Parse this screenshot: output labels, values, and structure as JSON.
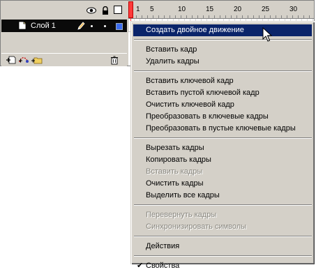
{
  "timeline": {
    "layer_name": "Слой 1",
    "ruler_ticks": [
      "1",
      "5",
      "10",
      "15",
      "20",
      "25",
      "30"
    ]
  },
  "menu": {
    "items": [
      {
        "label": "Создать двойное движение",
        "state": "highlighted"
      },
      {
        "separator": true
      },
      {
        "label": "Вставить кадр",
        "state": "enabled"
      },
      {
        "label": "Удалить кадры",
        "state": "enabled"
      },
      {
        "separator": true
      },
      {
        "label": "Вставить ключевой кадр",
        "state": "enabled"
      },
      {
        "label": "Вставить пустой ключевой кадр",
        "state": "enabled"
      },
      {
        "label": "Очистить ключевой кадр",
        "state": "enabled"
      },
      {
        "label": "Преобразовать в ключевые кадры",
        "state": "enabled"
      },
      {
        "label": "Преобразовать в пустые ключевые кадры",
        "state": "enabled"
      },
      {
        "separator": true
      },
      {
        "label": "Вырезать кадры",
        "state": "enabled"
      },
      {
        "label": "Копировать кадры",
        "state": "enabled"
      },
      {
        "label": "Вставить кадры",
        "state": "disabled"
      },
      {
        "label": "Очистить кадры",
        "state": "enabled"
      },
      {
        "label": "Выделить все кадры",
        "state": "enabled"
      },
      {
        "separator": true
      },
      {
        "label": "Перевернуть кадры",
        "state": "disabled"
      },
      {
        "label": "Синхронизировать символы",
        "state": "disabled"
      },
      {
        "separator": true
      },
      {
        "label": "Действия",
        "state": "enabled"
      },
      {
        "separator": true
      },
      {
        "label": "Свойства",
        "state": "enabled",
        "checked": true
      }
    ]
  },
  "icons": {
    "header": [
      "eye-icon",
      "lock-icon",
      "outline-icon"
    ],
    "layer": [
      "layer-page-icon",
      "pencil-icon"
    ],
    "footer": [
      "add-layer-icon",
      "add-guide-layer-icon",
      "insert-folder-icon",
      "trash-icon"
    ],
    "cursor": "arrow-cursor-icon"
  },
  "colors": {
    "panel": "#d4d0c8",
    "highlight": "#0a246a",
    "playhead": "#ff3a3a",
    "layer_row": "#0a0a0a",
    "outline_swatch": "#3b6cf0"
  }
}
